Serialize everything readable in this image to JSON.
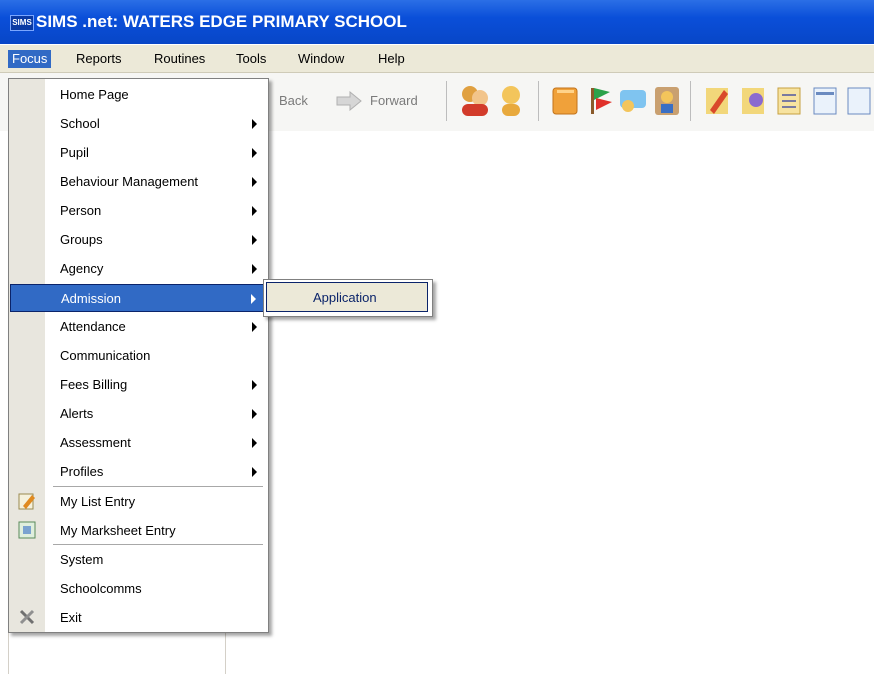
{
  "window": {
    "logo_text": "SIMS",
    "title": "SIMS .net: WATERS EDGE PRIMARY SCHOOL"
  },
  "menubar": {
    "items": [
      {
        "label": "Focus"
      },
      {
        "label": "Reports"
      },
      {
        "label": "Routines"
      },
      {
        "label": "Tools"
      },
      {
        "label": "Window"
      },
      {
        "label": "Help"
      }
    ]
  },
  "toolbar": {
    "back_label": "Back",
    "forward_label": "Forward",
    "icons": [
      "pupils-icon",
      "person-icon",
      "book-icon",
      "flag-icon",
      "communication-icon",
      "staff-icon",
      "marksheet-icon",
      "profiles-icon",
      "list-icon"
    ]
  },
  "focus_menu": {
    "items": [
      {
        "label": "Home Page",
        "submenu": false
      },
      {
        "label": "School",
        "submenu": true
      },
      {
        "label": "Pupil",
        "submenu": true
      },
      {
        "label": "Behaviour Management",
        "submenu": true
      },
      {
        "label": "Person",
        "submenu": true
      },
      {
        "label": "Groups",
        "submenu": true
      },
      {
        "label": "Agency",
        "submenu": true
      },
      {
        "label": "Admission",
        "submenu": true,
        "selected": true
      },
      {
        "label": "Attendance",
        "submenu": true
      },
      {
        "label": "Communication",
        "submenu": false
      },
      {
        "label": "Fees Billing",
        "submenu": true
      },
      {
        "label": "Alerts",
        "submenu": true
      },
      {
        "label": "Assessment",
        "submenu": true
      },
      {
        "label": "Profiles",
        "submenu": true
      },
      {
        "label": "My List Entry",
        "submenu": false,
        "icon": "list-entry-icon"
      },
      {
        "label": "My Marksheet Entry",
        "submenu": false,
        "icon": "marksheet-entry-icon"
      },
      {
        "label": "System",
        "submenu": false
      },
      {
        "label": "Schoolcomms",
        "submenu": false
      },
      {
        "label": "Exit",
        "submenu": false,
        "icon": "exit-icon"
      }
    ]
  },
  "admission_submenu": {
    "items": [
      {
        "label": "Application"
      }
    ]
  },
  "colors": {
    "titlebar": "#0a4fd9",
    "selection": "#316ac5",
    "menubar": "#ece9d8"
  }
}
